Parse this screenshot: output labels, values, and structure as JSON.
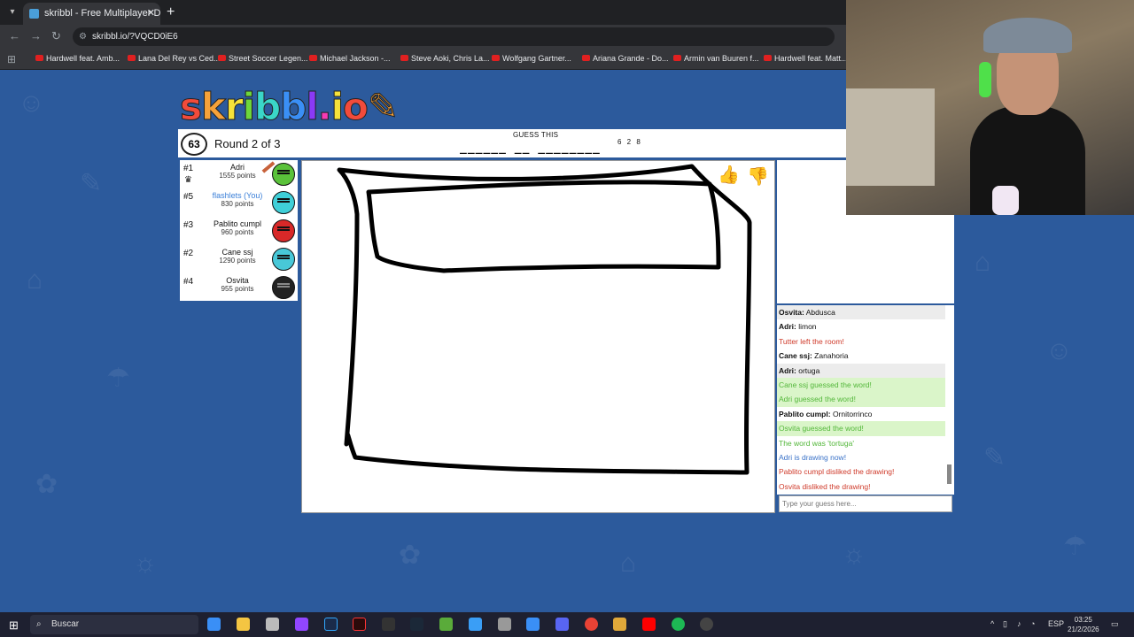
{
  "browser": {
    "tab_title": "skribbl - Free Multiplayer Draw",
    "tab_close": "✕",
    "new_tab": "+",
    "url": "skribbl.io/?VQCD0iE6",
    "bookmarks": [
      "Hardwell feat. Amb...",
      "Lana Del Rey vs Ced...",
      "Street Soccer Legen...",
      "Michael Jackson -...",
      "Steve Aoki, Chris La...",
      "Wolfgang Gartner...",
      "Ariana Grande - Do...",
      "Armin van Buuren f...",
      "Hardwell feat. Matt..."
    ]
  },
  "game": {
    "logo": "skribbl.io",
    "timer": "63",
    "round": "Round 2 of 3",
    "guess_title": "GUESS THIS",
    "guess_word": "______ __ ________",
    "word_lengths": "6 2 8"
  },
  "players": [
    {
      "rank": "#1",
      "name": "Adri",
      "points": "1555 points",
      "color": "#5ac23a",
      "drawing": true,
      "crown": true
    },
    {
      "rank": "#5",
      "name": "flashlets (You)",
      "points": "830 points",
      "color": "#3fcfd8",
      "me": true
    },
    {
      "rank": "#3",
      "name": "Pablito cumpl",
      "points": "960 points",
      "color": "#d82828"
    },
    {
      "rank": "#2",
      "name": "Cane ssj",
      "points": "1290 points",
      "color": "#48c8d8"
    },
    {
      "rank": "#4",
      "name": "Osvita",
      "points": "955 points",
      "color": "#222222"
    }
  ],
  "chat": {
    "messages": [
      {
        "author": "Osvita:",
        "text": "Abdusca",
        "style": "alt"
      },
      {
        "author": "Adri:",
        "text": "limon",
        "style": "plain"
      },
      {
        "author": "",
        "text": "Tutter left the room!",
        "style": "red"
      },
      {
        "author": "Cane ssj:",
        "text": "Zanahoria",
        "style": "plain"
      },
      {
        "author": "Adri:",
        "text": "ortuga",
        "style": "alt"
      },
      {
        "author": "",
        "text": "Cane ssj guessed the word!",
        "style": "green"
      },
      {
        "author": "",
        "text": "Adri guessed the word!",
        "style": "green"
      },
      {
        "author": "Pablito cumpl:",
        "text": "Ornitorrinco",
        "style": "plain"
      },
      {
        "author": "",
        "text": "Osvita guessed the word!",
        "style": "green"
      },
      {
        "author": "",
        "text": "The word was 'tortuga'",
        "style": "green-plain"
      },
      {
        "author": "",
        "text": "Adri is drawing now!",
        "style": "blue"
      },
      {
        "author": "",
        "text": "Pablito cumpl disliked the drawing!",
        "style": "red"
      },
      {
        "author": "",
        "text": "Osvita disliked the drawing!",
        "style": "red"
      }
    ],
    "input_placeholder": "Type your guess here..."
  },
  "taskbar": {
    "search_label": "Buscar",
    "language": "ESP",
    "time": "03:25",
    "date": "21/2/2026"
  },
  "colors": {
    "background": "#2c5a9c",
    "guess_green": "#53b73a",
    "alert_red": "#cf3a2a",
    "info_blue": "#3a72c8"
  }
}
